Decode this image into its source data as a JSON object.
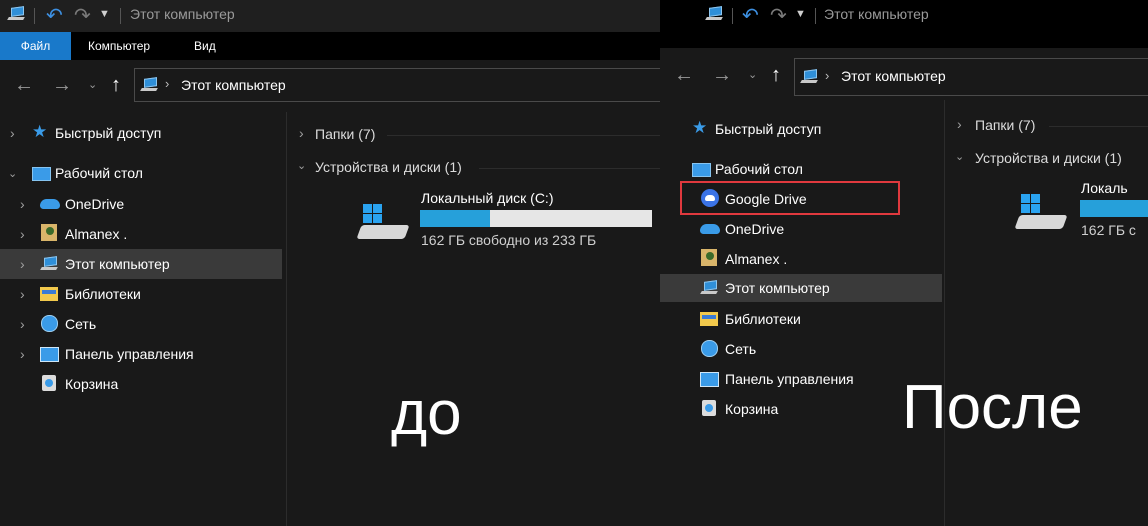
{
  "left": {
    "title": "Этот компьютер",
    "ribbon_tabs": [
      "Файл",
      "Компьютер",
      "Вид"
    ],
    "address": "Этот компьютер",
    "nav": {
      "quick_access": "Быстрый доступ",
      "desktop": "Рабочий стол",
      "onedrive": "OneDrive",
      "user": "Almanex .",
      "this_pc": "Этот компьютер",
      "libraries": "Библиотеки",
      "network": "Сеть",
      "control_panel": "Панель управления",
      "recycle_bin": "Корзина"
    },
    "folders_header": "Папки (7)",
    "devices_header": "Устройства и диски (1)",
    "disk": {
      "name": "Локальный диск (C:)",
      "free_text": "162 ГБ свободно из 233 ГБ",
      "used_fraction": 0.3
    },
    "caption": "до"
  },
  "right": {
    "title": "Этот компьютер",
    "address": "Этот компьютер",
    "nav": {
      "quick_access": "Быстрый доступ",
      "desktop": "Рабочий стол",
      "google_drive": "Google Drive",
      "onedrive": "OneDrive",
      "user": "Almanex .",
      "this_pc": "Этот компьютер",
      "libraries": "Библиотеки",
      "network": "Сеть",
      "control_panel": "Панель управления",
      "recycle_bin": "Корзина"
    },
    "folders_header": "Папки (7)",
    "devices_header": "Устройства и диски (1)",
    "disk": {
      "name": "Локаль",
      "free_text": "162 ГБ с",
      "used_fraction": 0.3
    },
    "caption": "После"
  },
  "colors": {
    "accent_blue": "#1979ca",
    "highlight_red": "#e0393e",
    "selected_bg": "#3a3a3a",
    "progress_fill": "#26a0da"
  }
}
